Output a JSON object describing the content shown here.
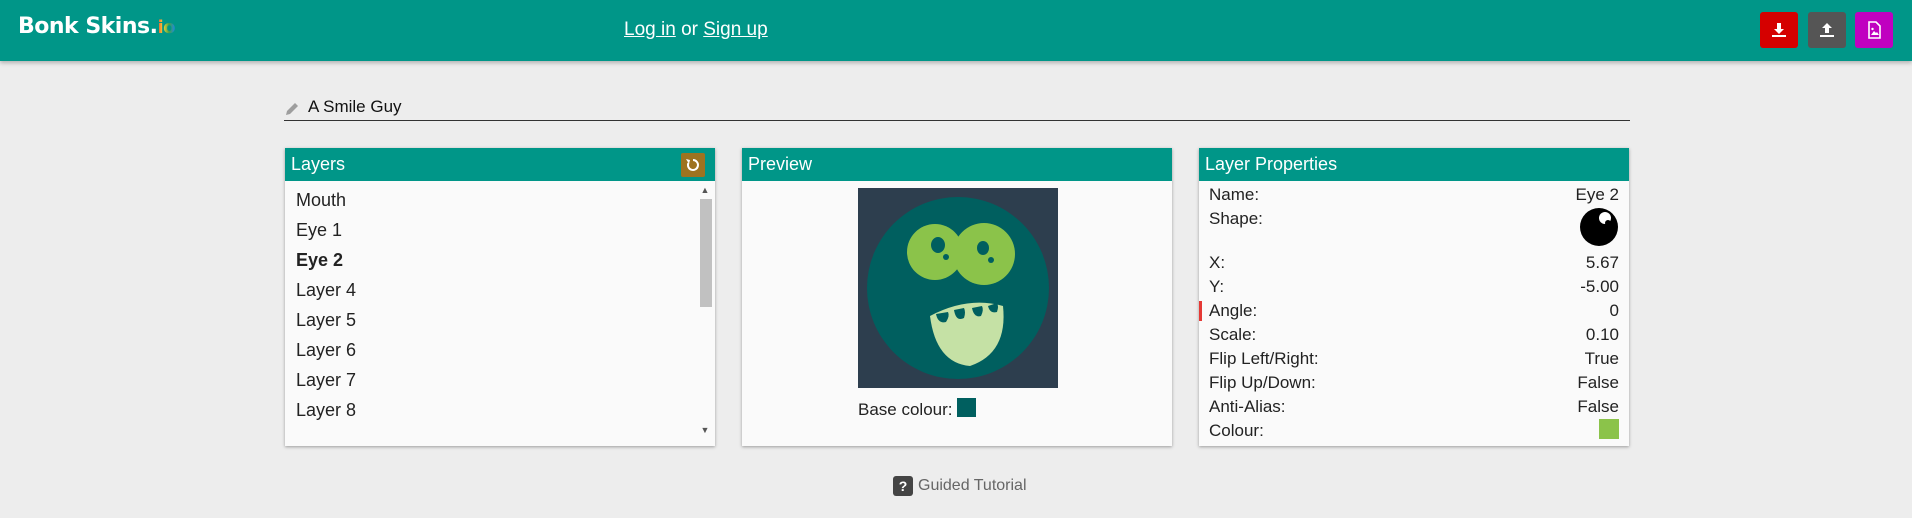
{
  "header": {
    "logo_main": "Bonk Skins.",
    "logo_io": "io",
    "login_label": "Log in",
    "or_label": "or",
    "signup_label": "Sign up",
    "buttons": [
      {
        "name": "download",
        "color": "#d50000"
      },
      {
        "name": "upload",
        "color": "#555555"
      },
      {
        "name": "save-image",
        "color": "#c000c0"
      }
    ]
  },
  "skin": {
    "name": "A Smile Guy"
  },
  "layers_panel": {
    "title": "Layers",
    "items": [
      "Mouth",
      "Eye 1",
      "Eye 2",
      "Layer 4",
      "Layer 5",
      "Layer 6",
      "Layer 7",
      "Layer 8"
    ],
    "selected": "Eye 2"
  },
  "preview_panel": {
    "title": "Preview",
    "base_colour_label": "Base colour:",
    "base_colour": "#005f5f"
  },
  "properties_panel": {
    "title": "Layer Properties",
    "name_label": "Name:",
    "name_value": "Eye 2",
    "shape_label": "Shape:",
    "x_label": "X:",
    "x_value": "5.67",
    "y_label": "Y:",
    "y_value": "-5.00",
    "angle_label": "Angle:",
    "angle_value": "0",
    "scale_label": "Scale:",
    "scale_value": "0.10",
    "flip_lr_label": "Flip Left/Right:",
    "flip_lr_value": "True",
    "flip_ud_label": "Flip Up/Down:",
    "flip_ud_value": "False",
    "antialias_label": "Anti-Alias:",
    "antialias_value": "False",
    "colour_label": "Colour:",
    "colour_value": "#8bc34a"
  },
  "tutorial": {
    "icon": "?",
    "label": "Guided Tutorial"
  },
  "colors": {
    "accent": "#009688",
    "background": "#ededed"
  }
}
